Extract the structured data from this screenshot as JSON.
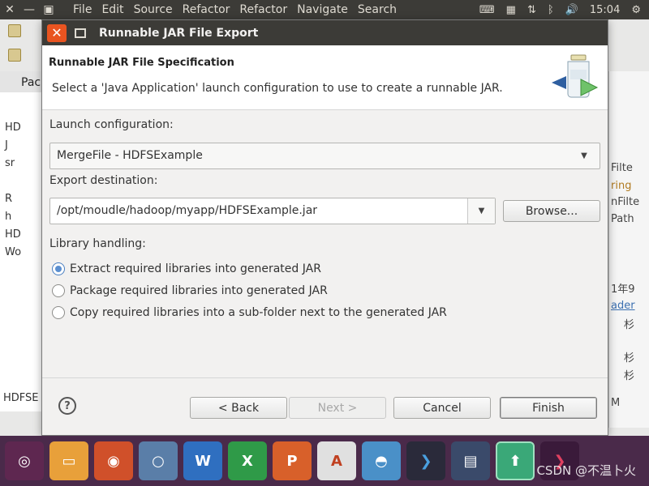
{
  "topbar": {
    "menus": [
      "File",
      "Edit",
      "Source",
      "Refactor",
      "Refactor",
      "Navigate",
      "Search"
    ],
    "time": "15:04",
    "icons": [
      "close-window-icon",
      "minimize-window-icon",
      "keyboard-icon",
      "calendar-icon",
      "network-icon",
      "bluetooth-icon",
      "volume-icon",
      "settings-icon"
    ]
  },
  "background": {
    "left_tab": "Pac",
    "left_tree": [
      "HD",
      "J",
      "sr",
      "",
      "R",
      "h",
      "HD",
      "Wo"
    ],
    "left_status": "HDFSE",
    "right_text": [
      "Filte",
      "ring",
      "nFilte",
      "Path",
      "1年9",
      "ader",
      "杉",
      "杉",
      "杉",
      "M"
    ]
  },
  "dialog": {
    "title": "Runnable JAR File Export",
    "header_title": "Runnable JAR File Specification",
    "header_desc": "Select a 'Java Application' launch configuration to use to create a runnable JAR.",
    "launch_label": "Launch configuration:",
    "launch_value": "MergeFile - HDFSExample",
    "dest_label": "Export destination:",
    "dest_value": "/opt/moudle/hadoop/myapp/HDFSExample.jar",
    "browse": "Browse...",
    "library_label": "Library handling:",
    "library_options": [
      "Extract required libraries into generated JAR",
      "Package required libraries into generated JAR",
      "Copy required libraries into a sub-folder next to the generated JAR"
    ],
    "selected_library": 0,
    "buttons": {
      "help": "?",
      "back": "< Back",
      "next": "Next >",
      "cancel": "Cancel",
      "finish": "Finish"
    }
  },
  "dock": {
    "items": [
      "ubuntu-icon",
      "files-icon",
      "firefox-icon",
      "chromium-icon",
      "writer-icon",
      "calc-icon",
      "impress-icon",
      "software-center-icon",
      "docker-icon",
      "vscode-icon",
      "window-switcher-icon",
      "jar-icon",
      "terminal-icon"
    ]
  },
  "watermark": "CSDN @不温卜火",
  "colors": {
    "titlebar": "#3c3b37",
    "close_button": "#e95420",
    "dock": "#4a2a4a",
    "dialog_bg": "#f2f1f0"
  }
}
